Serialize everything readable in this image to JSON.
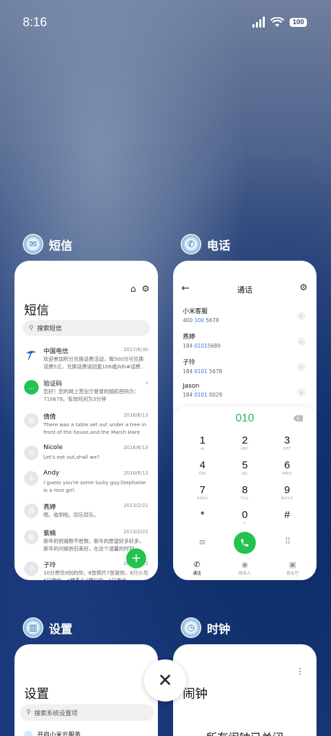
{
  "status_bar": {
    "time": "8:16",
    "battery": "100"
  },
  "sms_app": {
    "label": "短信",
    "title": "短信",
    "search_placeholder": "搜索短信",
    "messages": [
      {
        "avatar": "",
        "title": "中国电信",
        "date": "2017/6/30",
        "body": "欢迎参加积分兑换话费活动，每500分可兑换话费5元，兑换话费请回复106或jfdh#话费..."
      },
      {
        "avatar": "",
        "title": "验证码",
        "date": "",
        "body": "您好！您的网上营业厅登录的随机密码为：710679。有效时间为3分钟"
      },
      {
        "avatar": "倩",
        "title": "倩倩",
        "date": "2016/6/13",
        "body": "There was a table set out under a tree in front of the house,and the March Hare an..."
      },
      {
        "avatar": "N",
        "title": "Nicole",
        "date": "2016/6/13",
        "body": "Let's eat out,shall we?"
      },
      {
        "avatar": "A",
        "title": "Andy",
        "date": "2016/6/13",
        "body": "I guess you're some lucky guy.Stephanie is a nice girl."
      },
      {
        "avatar": "燕",
        "title": "燕婷",
        "date": "2013/2/22",
        "body": "嗯。收到啦。同乐同乐。"
      },
      {
        "avatar": "紫",
        "title": "紫楠",
        "date": "2013/2/22",
        "body": "新年的祝福数不胜数，新年的愿望好多好多，新年的问候依旧美好，在这个温馨的时刻..."
      },
      {
        "avatar": "子",
        "title": "子玲",
        "date": "2013/2/22",
        "body": "10分想念9别的你，8张照片7张是你，6只小鸟5只像你，4棵香头3棵归你，2只春光..."
      }
    ],
    "fab": "+"
  },
  "phone_app": {
    "label": "电话",
    "title": "通话",
    "contacts": [
      {
        "name": "小米客服",
        "pre": "400 ",
        "hl": "100",
        "post": " 5678"
      },
      {
        "name": "燕婷",
        "pre": "184 ",
        "hl": "0101",
        "post": "5689"
      },
      {
        "name": "子玲",
        "pre": "184 ",
        "hl": "0101",
        "post": " 5678"
      },
      {
        "name": "Jason",
        "pre": "184 ",
        "hl": "0101",
        "post": " 0029"
      }
    ],
    "dial_input": "010",
    "keys": [
      {
        "d": "1",
        "l": "ꝏ"
      },
      {
        "d": "2",
        "l": "ABC"
      },
      {
        "d": "3",
        "l": "DEF"
      },
      {
        "d": "4",
        "l": "GHI"
      },
      {
        "d": "5",
        "l": "JKL"
      },
      {
        "d": "6",
        "l": "MNO"
      },
      {
        "d": "7",
        "l": "PQRS"
      },
      {
        "d": "8",
        "l": "TUV"
      },
      {
        "d": "9",
        "l": "WXYZ"
      },
      {
        "d": "*",
        "l": ""
      },
      {
        "d": "0",
        "l": "+"
      },
      {
        "d": "#",
        "l": ""
      }
    ],
    "tabs": [
      "通话",
      "联系人",
      "营业厅"
    ]
  },
  "settings_app": {
    "label": "设置",
    "title": "设置",
    "search_placeholder": "搜索系统设置项",
    "first_item": "开启小米云服务"
  },
  "clock_app": {
    "label": "时钟",
    "title": "闹钟",
    "message": "所有闹钟已关闭"
  },
  "close_button": "✕"
}
